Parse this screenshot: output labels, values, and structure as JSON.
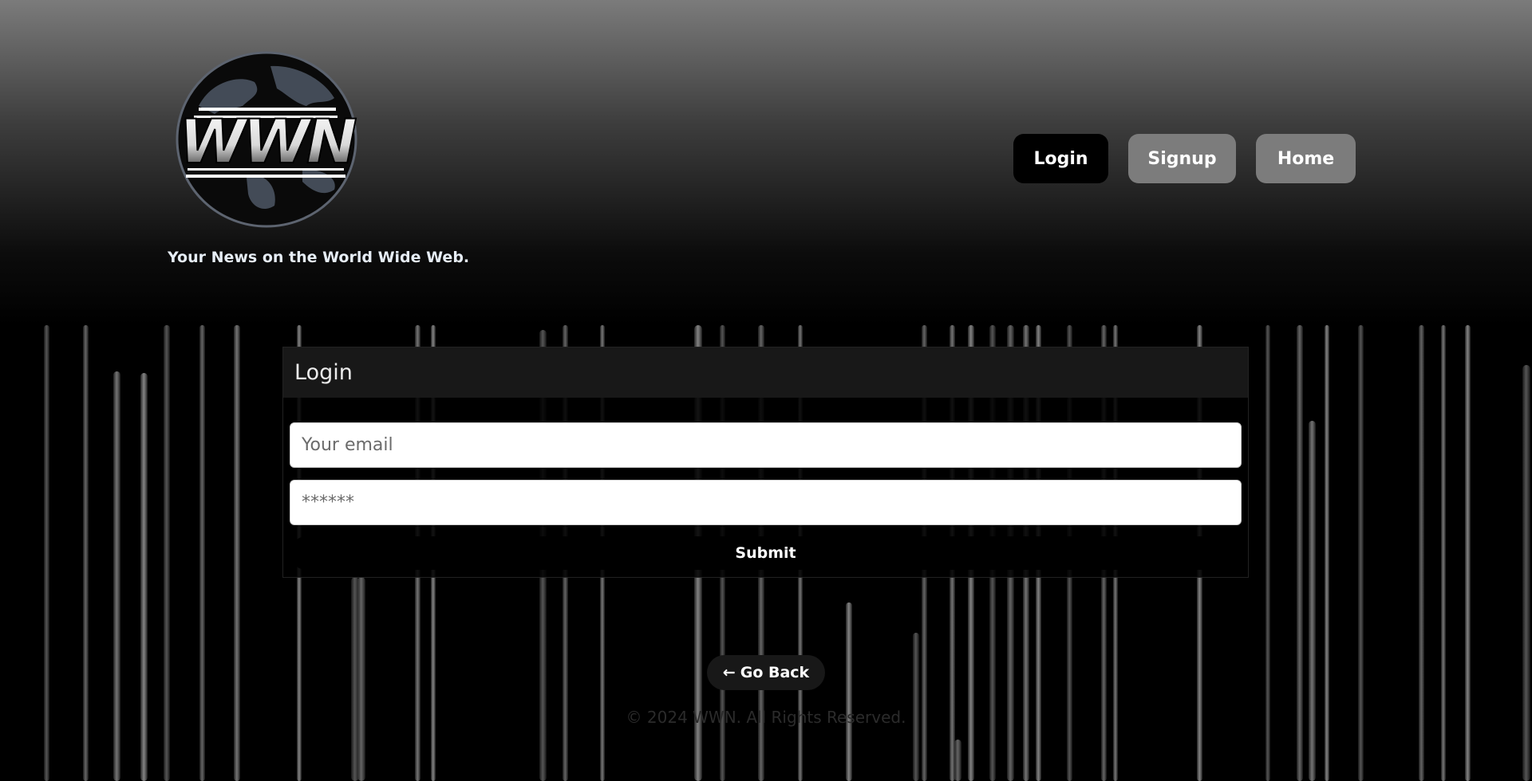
{
  "header": {
    "logo_text": "WWN",
    "tagline": "Your News on the World Wide Web."
  },
  "nav": {
    "login": "Login",
    "signup": "Signup",
    "home": "Home"
  },
  "login_form": {
    "title": "Login",
    "email_placeholder": "Your email",
    "password_placeholder": "******",
    "submit_label": "Submit"
  },
  "go_back": {
    "arrow": "←",
    "label": "Go Back"
  },
  "footer": {
    "copyright": "© 2024 WWN. All Rights Reserved."
  },
  "colors": {
    "nav_active": "#000000",
    "nav_inactive": "#7c7c7c",
    "card_header": "#181818"
  }
}
